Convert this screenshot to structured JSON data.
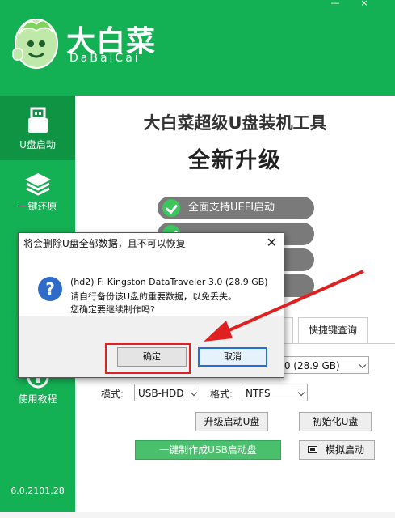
{
  "header": {
    "logo_cn": "大白菜",
    "logo_en": "DaBaiCai",
    "minimize_label": "—",
    "close_label": "×"
  },
  "sidebar": {
    "items": [
      {
        "label": "U盘启动",
        "icon": "usb-drive-icon"
      },
      {
        "label": "一键还原",
        "icon": "layers-icon"
      },
      {
        "label": "使用教程",
        "icon": "tutorial-icon"
      }
    ],
    "version": "6.0.2101.28"
  },
  "main": {
    "title": "大白菜超级U盘装机工具",
    "subtitle": "全新升级",
    "features": [
      {
        "label": "全面支持UEFI启动"
      },
      {
        "label": ""
      },
      {
        "label": ""
      },
      {
        "label": ""
      }
    ],
    "tabs": [
      {
        "label": ""
      },
      {
        "label": "快捷键查询"
      }
    ],
    "device_select": ".0 (28.9 GB)",
    "mode_label": "模式:",
    "mode_value": "USB-HDD",
    "format_label": "格式:",
    "format_value": "NTFS",
    "upgrade_button": "升级启动U盘",
    "init_button": "初始化U盘",
    "make_button": "一键制作成USB启动盘",
    "simulate_button": "模拟启动"
  },
  "dialog": {
    "title": "将会删除U盘全部数据，且不可以恢复",
    "close": "✕",
    "line1": "(hd2) F: Kingston DataTraveler 3.0 (28.9 GB)",
    "line2": "请自行备份该U盘的重要数据，以免丢失。",
    "line3": "您确定要继续制作吗?",
    "ok": "确定",
    "cancel": "取消"
  },
  "colors": {
    "brand_green": "#14b054",
    "annotation_red": "#e02020"
  }
}
